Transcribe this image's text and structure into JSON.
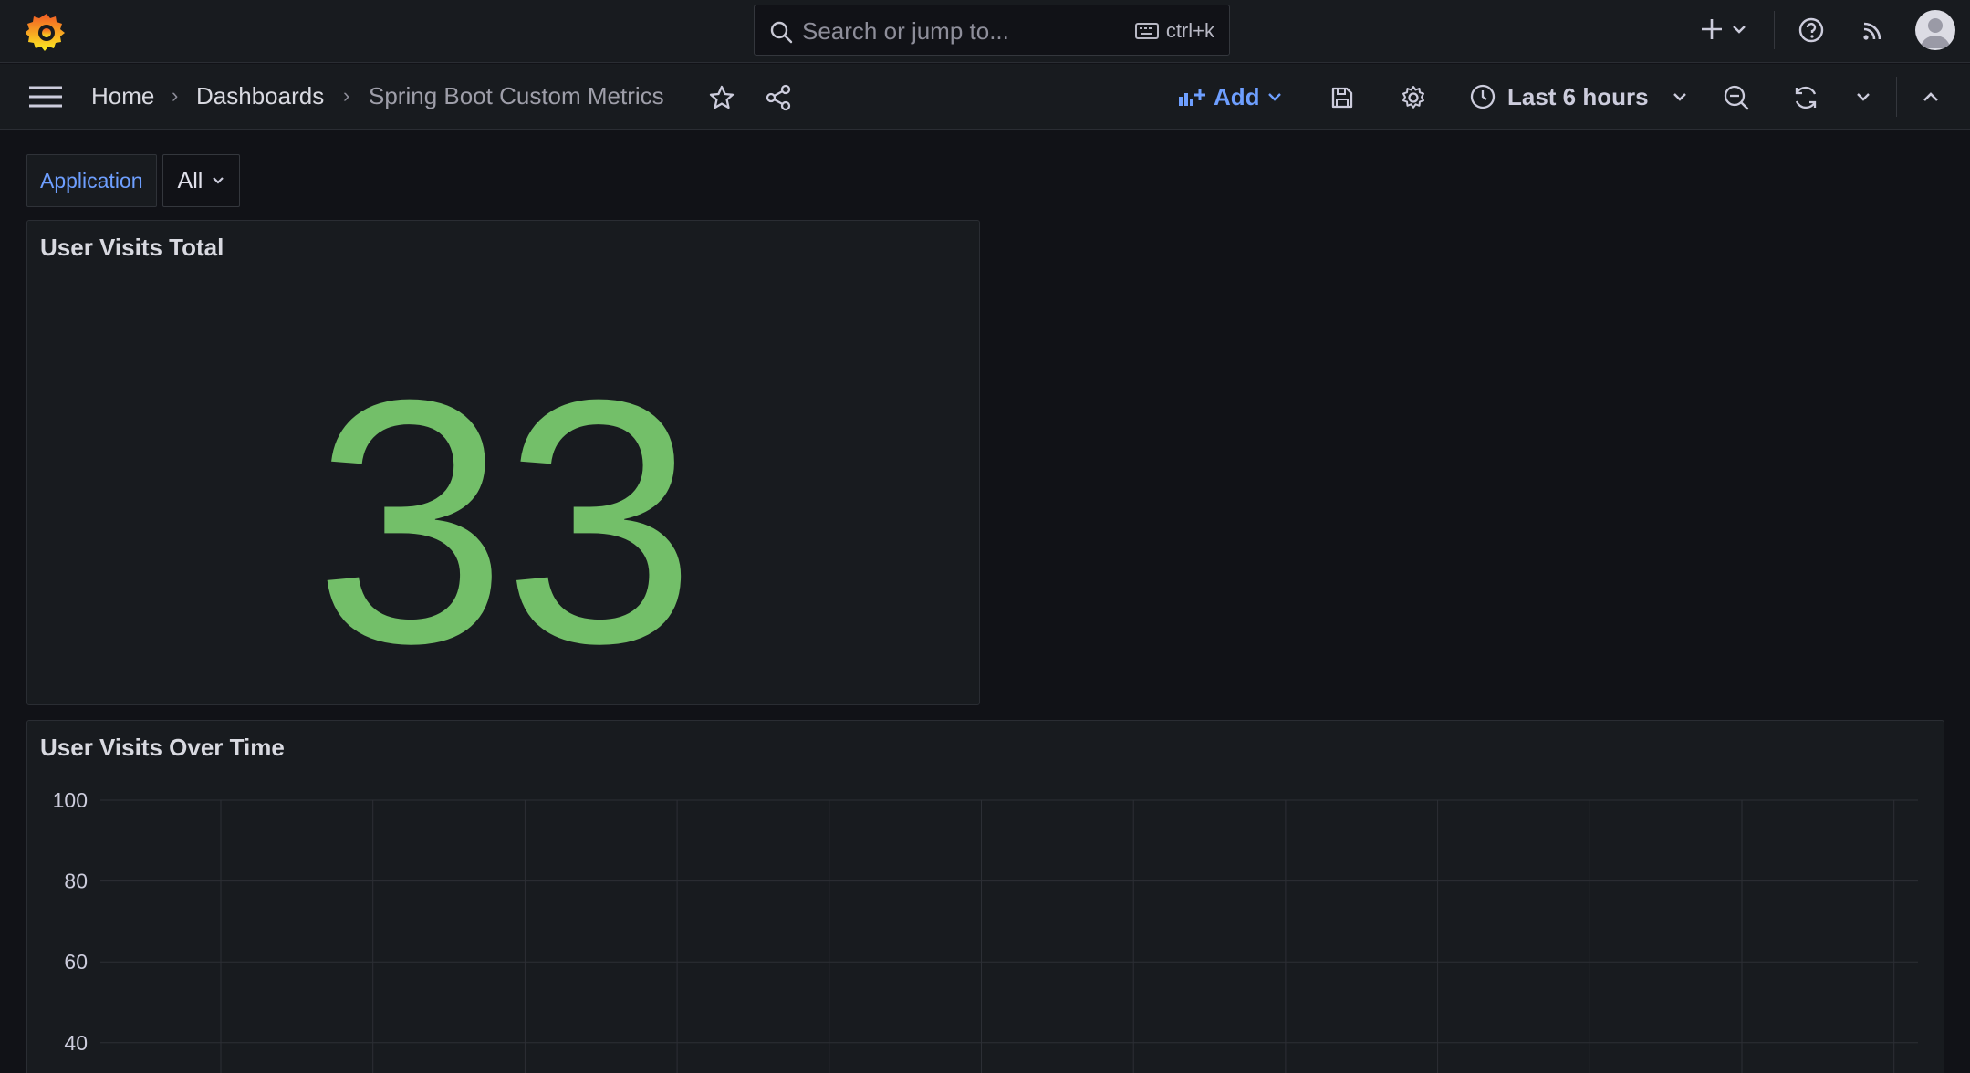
{
  "topbar": {
    "search": {
      "placeholder": "Search or jump to...",
      "shortcut": "ctrl+k"
    },
    "icons": [
      "grafana-logo",
      "search-icon",
      "keyboard-icon",
      "plus-icon",
      "chevron-down-icon",
      "help-icon",
      "news-icon",
      "avatar"
    ]
  },
  "navbar": {
    "breadcrumbs": [
      "Home",
      "Dashboards",
      "Spring Boot Custom Metrics"
    ],
    "add_label": "Add",
    "time_range": "Last 6 hours"
  },
  "variables": [
    {
      "label": "Application",
      "value": "All"
    }
  ],
  "panels": {
    "stat": {
      "title": "User Visits Total",
      "value": "33",
      "color": "#73bf69"
    },
    "timeseries": {
      "title": "User Visits Over Time"
    }
  },
  "chart_data": {
    "type": "line",
    "title": "User Visits Over Time",
    "y_ticks": [
      "100",
      "80",
      "60",
      "40"
    ],
    "ylim": [
      40,
      100
    ],
    "grid": true,
    "series": []
  },
  "colors": {
    "accent": "#6e9fff",
    "stat_green": "#73bf69",
    "background": "#111217",
    "panel": "#181b1f"
  }
}
